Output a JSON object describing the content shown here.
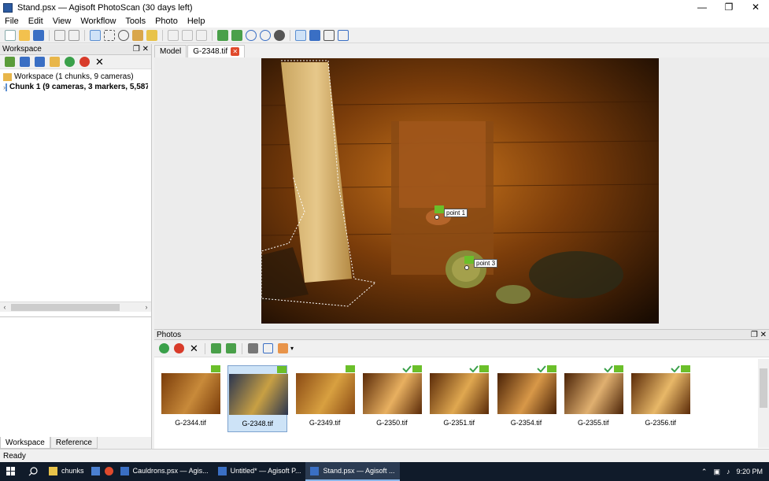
{
  "window": {
    "title": "Stand.psx — Agisoft PhotoScan (30 days left)",
    "controls": {
      "minimize": "—",
      "maximize": "❐",
      "close": "✕"
    }
  },
  "menu": [
    "File",
    "Edit",
    "View",
    "Workflow",
    "Tools",
    "Photo",
    "Help"
  ],
  "workspace_panel": {
    "title": "Workspace",
    "tree": [
      {
        "label": "Workspace (1 chunks, 9 cameras)",
        "bold": false
      },
      {
        "label": "Chunk 1 (9 cameras, 3 markers, 5,587",
        "bold": true
      }
    ],
    "tabs": [
      "Workspace",
      "Reference"
    ],
    "active_tab": "Workspace"
  },
  "viewer": {
    "tabs": [
      {
        "label": "Model",
        "active": false
      },
      {
        "label": "G-2348.tif",
        "active": true
      }
    ],
    "markers": [
      {
        "label": "point 1"
      },
      {
        "label": "point 3"
      }
    ]
  },
  "photos_panel": {
    "title": "Photos",
    "items": [
      {
        "label": "G-2344.tif",
        "selected": false,
        "flag": true,
        "check": false
      },
      {
        "label": "G-2348.tif",
        "selected": true,
        "flag": true,
        "check": false
      },
      {
        "label": "G-2349.tif",
        "selected": false,
        "flag": true,
        "check": false
      },
      {
        "label": "G-2350.tif",
        "selected": false,
        "flag": true,
        "check": true
      },
      {
        "label": "G-2351.tif",
        "selected": false,
        "flag": true,
        "check": true
      },
      {
        "label": "G-2354.tif",
        "selected": false,
        "flag": true,
        "check": true
      },
      {
        "label": "G-2355.tif",
        "selected": false,
        "flag": true,
        "check": true
      },
      {
        "label": "G-2356.tif",
        "selected": false,
        "flag": true,
        "check": true
      }
    ]
  },
  "status": "Ready",
  "taskbar": {
    "items": [
      {
        "label": "chunks",
        "active": false
      },
      {
        "label": "Cauldrons.psx — Agis...",
        "active": false
      },
      {
        "label": "Untitled* — Agisoft P...",
        "active": false
      },
      {
        "label": "Stand.psx — Agisoft ...",
        "active": true
      }
    ],
    "time": "9:20 PM"
  },
  "colors": {
    "accent": "#3c7fd0",
    "flag_green": "#6bbf2a",
    "taskbar_bg": "#101b2a",
    "close_red": "#e04a2c"
  }
}
